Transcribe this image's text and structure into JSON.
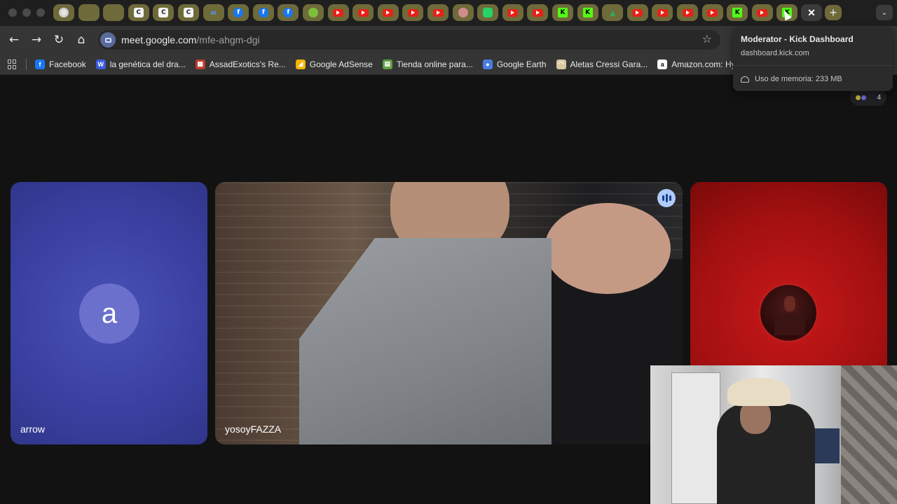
{
  "window": {
    "tabs": [
      {
        "icon": "chrome-icon"
      },
      {
        "icon": "cloud-icon"
      },
      {
        "icon": "cloud-icon"
      },
      {
        "icon": "c-icon",
        "letter": "C"
      },
      {
        "icon": "c-icon",
        "letter": "C"
      },
      {
        "icon": "c-icon",
        "letter": "C"
      },
      {
        "icon": "meta-icon",
        "letter": "∞"
      },
      {
        "icon": "facebook-icon",
        "letter": "f"
      },
      {
        "icon": "facebook-icon",
        "letter": "f"
      },
      {
        "icon": "facebook-icon",
        "letter": "f"
      },
      {
        "icon": "green-icon"
      },
      {
        "icon": "youtube-icon"
      },
      {
        "icon": "youtube-icon"
      },
      {
        "icon": "youtube-icon"
      },
      {
        "icon": "youtube-icon"
      },
      {
        "icon": "youtube-icon"
      },
      {
        "icon": "pink-icon"
      },
      {
        "icon": "whatsapp-icon"
      },
      {
        "icon": "youtube-icon"
      },
      {
        "icon": "youtube-icon"
      },
      {
        "icon": "kick-icon",
        "letter": "K"
      },
      {
        "icon": "kick-icon",
        "letter": "K"
      },
      {
        "icon": "drive-icon",
        "letter": "▲"
      },
      {
        "icon": "youtube-icon"
      },
      {
        "icon": "youtube-icon"
      },
      {
        "icon": "youtube-icon"
      },
      {
        "icon": "youtube-icon"
      },
      {
        "icon": "kick-icon",
        "letter": "K"
      },
      {
        "icon": "youtube-icon"
      },
      {
        "icon": "kick-icon",
        "letter": "K"
      }
    ],
    "active_tab_close": "✕",
    "new_tab": "+",
    "tab_menu": "⌄"
  },
  "toolbar": {
    "back": "←",
    "forward": "→",
    "reload": "↻",
    "home": "⌂",
    "url_host": "meet.google.com",
    "url_path": "/mfe-ahgm-dgi",
    "bookmark_star": "☆"
  },
  "bookmarks": [
    {
      "label": "Facebook",
      "icon": "facebook-icon",
      "color": "#1877f2",
      "glyph": "f"
    },
    {
      "label": "la genética del dra...",
      "icon": "w-icon",
      "color": "#3b5bdb",
      "glyph": "W"
    },
    {
      "label": "AssadExotics's Re...",
      "icon": "assad-icon",
      "color": "#c0392b",
      "glyph": "▦"
    },
    {
      "label": "Google AdSense",
      "icon": "adsense-icon",
      "color": "#f4b400",
      "glyph": "◢"
    },
    {
      "label": "Tienda online para...",
      "icon": "store-icon",
      "color": "#5fa042",
      "glyph": "▤"
    },
    {
      "label": "Google Earth",
      "icon": "earth-icon",
      "color": "#4a7de0",
      "glyph": "●"
    },
    {
      "label": "Aletas Cressi Gara...",
      "icon": "cressi-icon",
      "color": "#d9c9a3",
      "glyph": "◠"
    },
    {
      "label": "Amazon.com: Hyd...",
      "icon": "amazon-icon",
      "color": "#ffffff",
      "glyph": "a"
    }
  ],
  "meet": {
    "participant_count": "4",
    "tiles": [
      {
        "name": "arrow",
        "avatar_letter": "a",
        "color": "#3a40a0"
      },
      {
        "name": "yosoyFAZZA",
        "speaking": true
      },
      {
        "name": "",
        "color": "#a21010"
      }
    ]
  },
  "hovercard": {
    "title": "Moderator - Kick Dashboard",
    "domain": "dashboard.kick.com",
    "memory": "Uso de memoria: 233 MB"
  },
  "colors": {
    "tab_bg": "#6e6a3a",
    "toolbar_bg": "#353535",
    "accent": "#aecbfa"
  }
}
